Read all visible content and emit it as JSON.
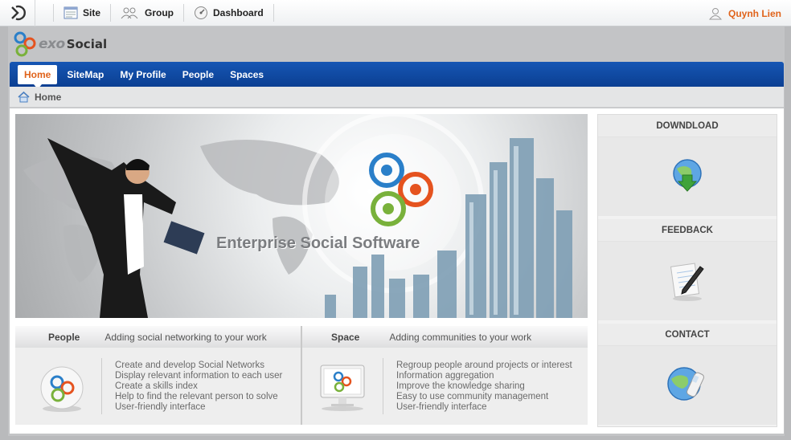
{
  "toolbar": {
    "site": "Site",
    "group": "Group",
    "dashboard": "Dashboard",
    "user": "Quynh Lien"
  },
  "brand": {
    "exo": "exo",
    "social": "Social"
  },
  "nav": {
    "items": [
      "Home",
      "SiteMap",
      "My Profile",
      "People",
      "Spaces"
    ],
    "active": "Home"
  },
  "breadcrumb": {
    "current": "Home"
  },
  "banner": {
    "title": "Enterprise Social Software"
  },
  "people_section": {
    "title": "People",
    "subtitle": "Adding social networking to your work",
    "items": [
      "Create and develop Social Networks",
      "Display relevant information to each user",
      "Create a skills index",
      "Help to find the relevant person to solve",
      "User-friendly interface"
    ]
  },
  "space_section": {
    "title": "Space",
    "subtitle": "Adding communities to your work",
    "items": [
      "Regroup people around projects or interest",
      "Information aggregation",
      "Improve the knowledge sharing",
      "Easy to use community management",
      "User-friendly interface"
    ]
  },
  "sidebar": {
    "download": "DOWNDLOAD",
    "feedback": "FEEDBACK",
    "contact": "CONTACT"
  },
  "colors": {
    "nav_blue": "#1656b4",
    "accent_orange": "#e0631b"
  }
}
